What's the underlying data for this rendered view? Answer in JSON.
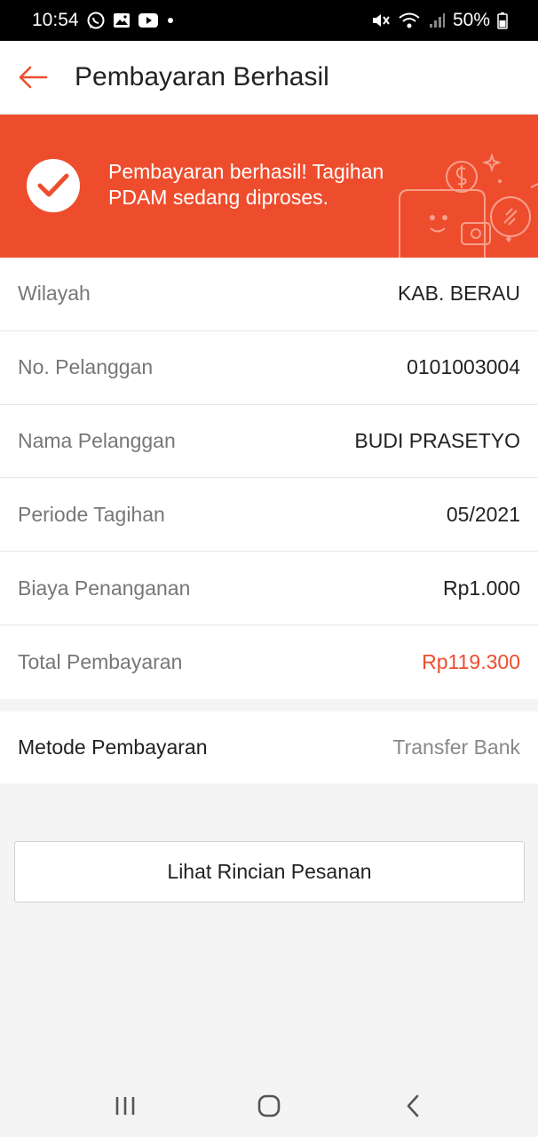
{
  "status_bar": {
    "time": "10:54",
    "battery": "50%",
    "left_icons": [
      "whatsapp-icon",
      "gallery-icon",
      "youtube-icon",
      "dot-icon"
    ],
    "right_icons": [
      "mute-icon",
      "wifi-icon",
      "signal-icon",
      "battery-icon"
    ]
  },
  "header": {
    "title": "Pembayaran Berhasil",
    "back_icon": "arrow-left-icon"
  },
  "banner": {
    "message": "Pembayaran berhasil! Tagihan PDAM sedang diproses.",
    "icon": "check-circle-icon",
    "decoration": "wallet-coins-illustration"
  },
  "details": [
    {
      "label": "Wilayah",
      "value": "KAB. BERAU"
    },
    {
      "label": "No. Pelanggan",
      "value": "0101003004"
    },
    {
      "label": "Nama Pelanggan",
      "value": "BUDI PRASETYO"
    },
    {
      "label": "Periode Tagihan",
      "value": "05/2021"
    },
    {
      "label": "Biaya Penanganan",
      "value": "Rp1.000"
    },
    {
      "label": "Total Pembayaran",
      "value": "Rp119.300"
    }
  ],
  "payment_method": {
    "label": "Metode Pembayaran",
    "value": "Transfer Bank"
  },
  "actions": {
    "view_details_label": "Lihat Rincian Pesanan"
  },
  "nav_bar": {
    "icons": [
      "recent-apps-icon",
      "home-icon",
      "back-icon"
    ]
  },
  "colors": {
    "accent": "#ee4d2d",
    "status_bar": "#000000",
    "background": "#f4f4f4"
  }
}
